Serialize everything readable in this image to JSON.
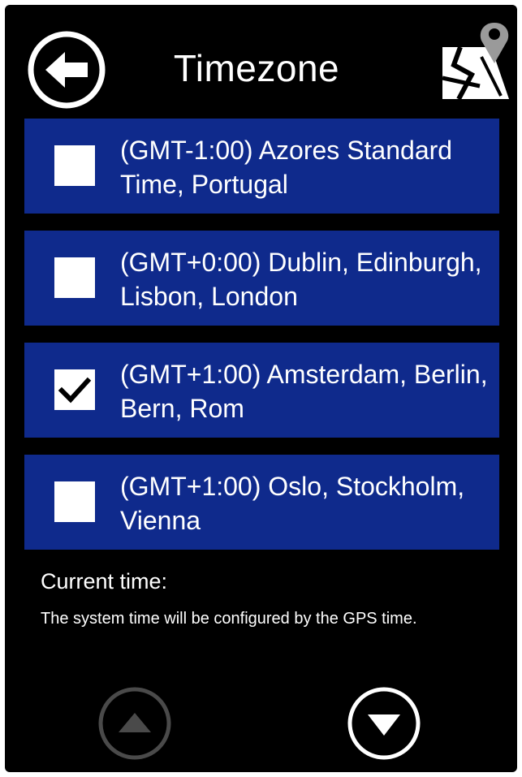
{
  "header": {
    "title": "Timezone",
    "back_icon": "arrow-left-icon",
    "map_icon": "map-location-icon"
  },
  "timezones": [
    {
      "label": "(GMT-1:00) Azores Standard Time, Portugal",
      "checked": false
    },
    {
      "label": "(GMT+0:00) Dublin, Edinburgh, Lisbon, London",
      "checked": false
    },
    {
      "label": "(GMT+1:00) Amsterdam, Berlin, Bern, Rom",
      "checked": true
    },
    {
      "label": "(GMT+1:00) Oslo, Stockholm, Vienna",
      "checked": false
    }
  ],
  "current_time": {
    "label": "Current time:",
    "info": "The system time will be configured by the GPS time."
  },
  "scroll": {
    "up_icon": "triangle-up-icon",
    "down_icon": "triangle-down-icon",
    "up_enabled": false,
    "down_enabled": true
  },
  "colors": {
    "background": "#000000",
    "item_background": "#0f2a8c",
    "text": "#ffffff",
    "disabled": "#4a4a4a"
  }
}
